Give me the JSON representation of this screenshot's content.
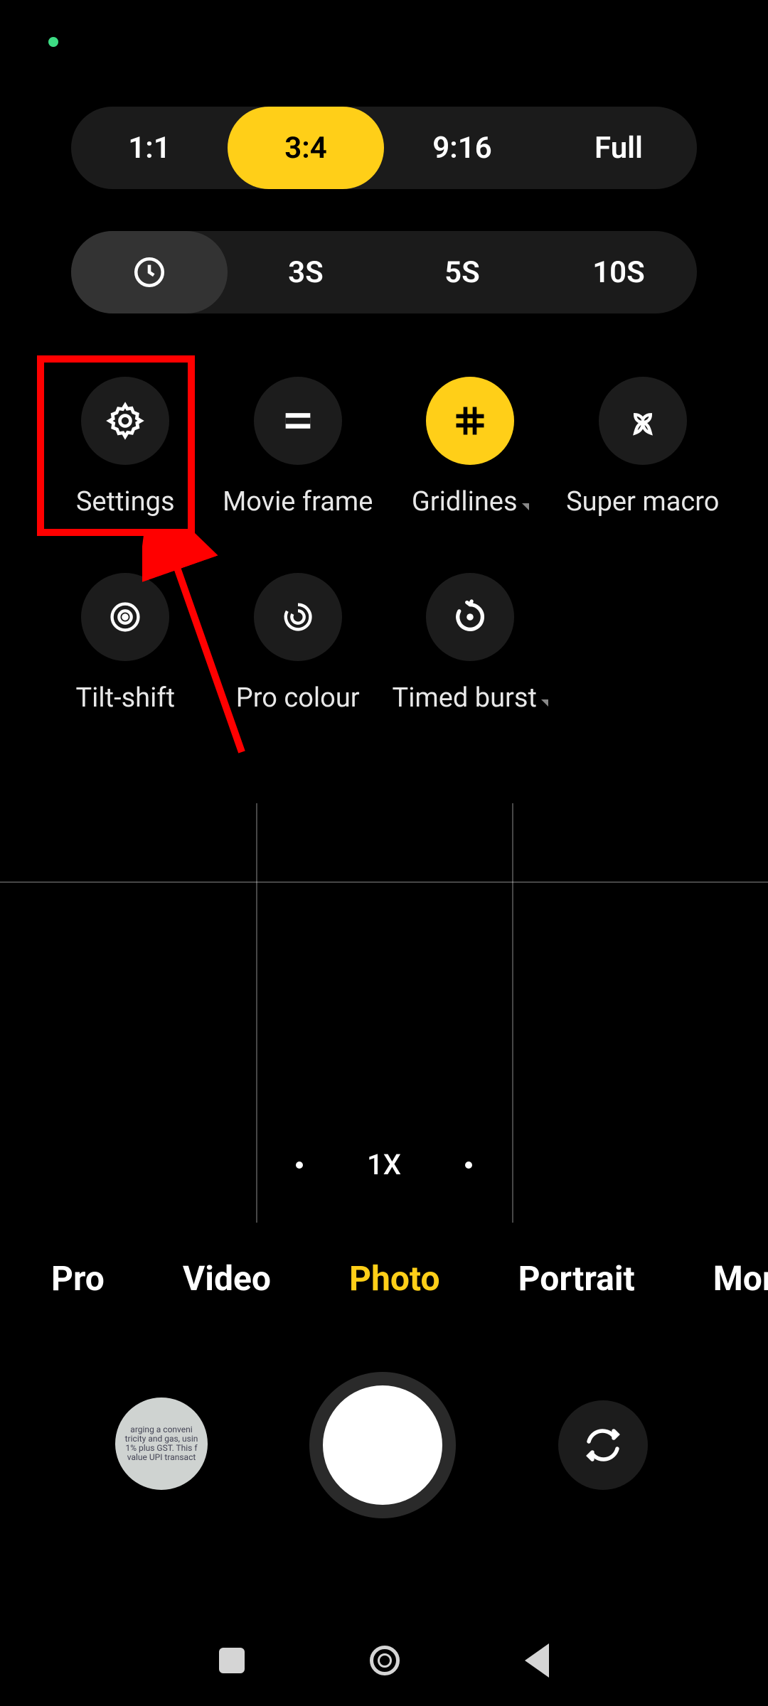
{
  "status": {
    "indicator_color": "#3ddc84"
  },
  "aspect_ratios": {
    "options": [
      "1:1",
      "3:4",
      "9:16",
      "Full"
    ],
    "active_index": 1
  },
  "timer": {
    "icon": "clock-icon",
    "options": [
      "3S",
      "5S",
      "10S"
    ],
    "active_icon": true
  },
  "options_row1": [
    {
      "key": "settings",
      "label": "Settings",
      "icon": "gear-icon",
      "active": false,
      "dropdown": false
    },
    {
      "key": "movieframe",
      "label": "Movie frame",
      "icon": "rectangle-icon",
      "active": false,
      "dropdown": false
    },
    {
      "key": "gridlines",
      "label": "Gridlines",
      "icon": "grid-icon",
      "active": true,
      "dropdown": true
    },
    {
      "key": "supermacro",
      "label": "Super macro",
      "icon": "flower-icon",
      "active": false,
      "dropdown": false
    }
  ],
  "options_row2": [
    {
      "key": "tiltshift",
      "label": "Tilt-shift",
      "icon": "target-icon",
      "active": false,
      "dropdown": false
    },
    {
      "key": "procolour",
      "label": "Pro colour",
      "icon": "spiral-icon",
      "active": false,
      "dropdown": false
    },
    {
      "key": "timedburst",
      "label": "Timed burst",
      "icon": "timer-arc-icon",
      "active": false,
      "dropdown": true
    }
  ],
  "zoom": {
    "current": "1X"
  },
  "modes": {
    "items": [
      "Pro",
      "Video",
      "Photo",
      "Portrait",
      "More"
    ],
    "active_index": 2
  },
  "annotation": {
    "highlight_target": "settings",
    "color": "#ff0000"
  },
  "gallery_preview_text": "arging a conveni tricity and gas, usin 1% plus GST. This f value UPI transact"
}
